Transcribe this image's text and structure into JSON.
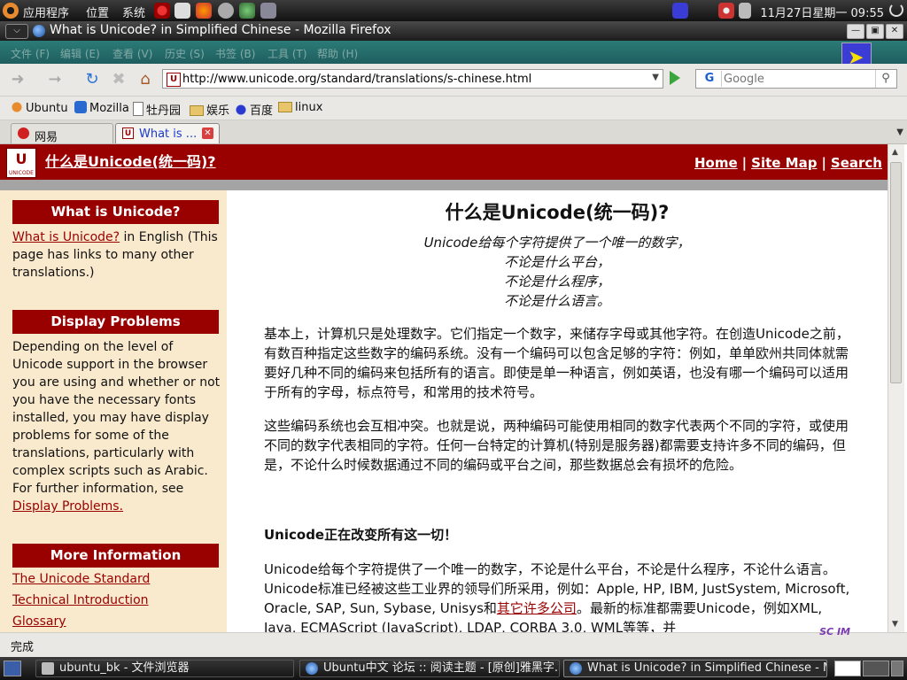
{
  "top_panel": {
    "menus": [
      "应用程序",
      "位置",
      "系统"
    ],
    "clock": "11月27日星期一 09:55"
  },
  "window": {
    "title": "What is Unicode? in Simplified Chinese - Mozilla Firefox"
  },
  "menubar": [
    "文件 (F)",
    "编辑 (E)",
    "查看 (V)",
    "历史 (S)",
    "书签 (B)",
    "工具 (T)",
    "帮助 (H)"
  ],
  "navbar": {
    "url": "http://www.unicode.org/standard/translations/s-chinese.html",
    "search_placeholder": "Google",
    "search_engine_letter": "G"
  },
  "bookmarks": [
    "Ubuntu",
    "Mozilla",
    "牡丹园",
    "娱乐",
    "百度",
    "linux"
  ],
  "tabs": [
    {
      "label": "网易",
      "active": false
    },
    {
      "label": "What is ...",
      "active": true
    }
  ],
  "page": {
    "logo_mark": "U",
    "logo_text": "UNICODE",
    "header_title": "什么是Unicode(统一码)?",
    "header_links": [
      "Home",
      "Site Map",
      "Search"
    ],
    "sidebar": {
      "what_heading": "What is Unicode?",
      "what_link": "What is Unicode?",
      "what_text": " in English (This page has links to many other translations.)",
      "display_heading": "Display Problems",
      "display_text": "Depending on the level of Unicode support in the browser you are using and whether or not you have the necessary fonts installed, you may have display problems for some of the translations, particularly with complex scripts such as Arabic. For further information, see ",
      "display_link": "Display Problems.",
      "more_heading": "More Information",
      "more_links": [
        "The Unicode Standard",
        "Technical Introduction",
        "Glossary"
      ]
    },
    "main": {
      "title": "什么是Unicode(统一码)?",
      "tagline": [
        "Unicode给每个字符提供了一个唯一的数字，",
        "不论是什么平台，",
        "不论是什么程序，",
        "不论是什么语言。"
      ],
      "para1": "基本上，计算机只是处理数字。它们指定一个数字，来储存字母或其他字符。在创造Unicode之前，有数百种指定这些数字的编码系统。没有一个编码可以包含足够的字符：例如，单单欧州共同体就需要好几种不同的编码来包括所有的语言。即使是单一种语言，例如英语，也没有哪一个编码可以适用于所有的字母，标点符号，和常用的技术符号。",
      "para2": "这些编码系统也会互相冲突。也就是说，两种编码可能使用相同的数字代表两个不同的字符，或使用不同的数字代表相同的字符。任何一台特定的计算机(特别是服务器)都需要支持许多不同的编码，但是，不论什么时候数据通过不同的编码或平台之间，那些数据总会有损坏的危险。",
      "subheading": "Unicode正在改变所有这一切！",
      "para3_a": "Unicode给每个字符提供了一个唯一的数字，不论是什么平台，不论是什么程序，不论什么语言。Unicode标准已经被这些工业界的领导们所采用，例如：Apple, HP, IBM, JustSystem, Microsoft, Oracle, SAP, Sun, Sybase, Unisys和",
      "para3_link": "其它许多公司",
      "para3_b": "。最新的标准都需要Unicode，例如XML, Java, ECMAScript (JavaScript), LDAP, CORBA 3.0, WML等等，并"
    }
  },
  "statusbar": {
    "text": "完成",
    "scim": "SC IM"
  },
  "taskbar": [
    "ubuntu_bk - 文件浏览器",
    "Ubuntu中文 论坛 :: 阅读主题 - [原创]雅黑字...",
    "What is Unicode? in Simplified Chinese - M..."
  ],
  "colors": {
    "unicode_red": "#990000",
    "sidebar_bg": "#f9e9cd",
    "menubar_teal": "#237070"
  }
}
